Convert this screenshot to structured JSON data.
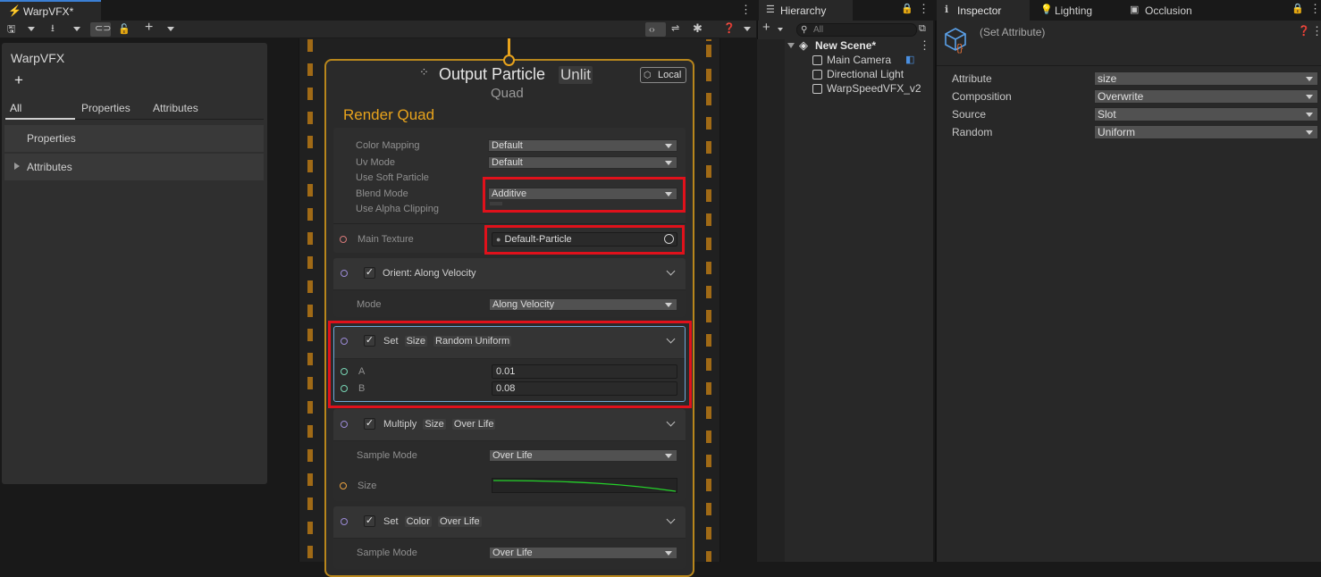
{
  "window": {
    "title": "WarpVFX*"
  },
  "toolbar": {
    "icons": [
      "save-icon",
      "dropdown-icon",
      "export-icon",
      "dropdown-icon",
      "link-icon",
      "lock-icon",
      "add-icon",
      "dropdown-icon",
      "code-icon",
      "settings-sliders-icon",
      "bug-icon",
      "help-icon",
      "dropdown-icon"
    ]
  },
  "blackboard": {
    "title": "WarpVFX",
    "add": "+",
    "tabs": [
      "All",
      "Properties",
      "Attributes"
    ],
    "sections": [
      "Properties",
      "Attributes"
    ]
  },
  "context": {
    "title": "Output Particle",
    "subtitle_tag": "Unlit",
    "type": "Quad",
    "space": "Local",
    "section_title": "Render Quad",
    "settings": [
      {
        "label": "Color Mapping",
        "value": "Default"
      },
      {
        "label": "Uv Mode",
        "value": "Default"
      },
      {
        "label": "Use Soft Particle",
        "value": ""
      },
      {
        "label": "Blend Mode",
        "value": "Additive"
      },
      {
        "label": "Use Alpha Clipping",
        "value": ""
      }
    ],
    "main_texture": {
      "label": "Main Texture",
      "value": "Default-Particle"
    },
    "blocks": [
      {
        "title_parts": [
          "Orient: Along Velocity"
        ],
        "rows": [
          {
            "label": "Mode",
            "value": "Along Velocity"
          }
        ]
      },
      {
        "title_parts": [
          "Set",
          "Size",
          "Random Uniform"
        ],
        "rows": [
          {
            "label": "A",
            "value": "0.01"
          },
          {
            "label": "B",
            "value": "0.08"
          }
        ]
      },
      {
        "title_parts": [
          "Multiply",
          "Size",
          "Over Life"
        ],
        "rows": [
          {
            "label": "Sample Mode",
            "value": "Over Life"
          },
          {
            "label": "Size",
            "value": ""
          }
        ]
      },
      {
        "title_parts": [
          "Set",
          "Color",
          "Over Life"
        ],
        "rows": [
          {
            "label": "Sample Mode",
            "value": "Over Life"
          }
        ]
      }
    ]
  },
  "hierarchy": {
    "tab": "Hierarchy",
    "search_placeholder": "All",
    "scene": "New Scene*",
    "items": [
      "Main Camera",
      "Directional Light",
      "WarpSpeedVFX_v2"
    ]
  },
  "inspector": {
    "tabs": [
      "Inspector",
      "Lighting",
      "Occlusion"
    ],
    "title": "(Set Attribute)",
    "fields": [
      {
        "label": "Attribute",
        "value": "size"
      },
      {
        "label": "Composition",
        "value": "Overwrite"
      },
      {
        "label": "Source",
        "value": "Slot"
      },
      {
        "label": "Random",
        "value": "Uniform"
      }
    ]
  },
  "colors": {
    "accent_orange": "#e8a31c",
    "highlight_red": "#e0111b",
    "selection_blue": "#6fa8d8",
    "curve_green": "#25d22a"
  }
}
